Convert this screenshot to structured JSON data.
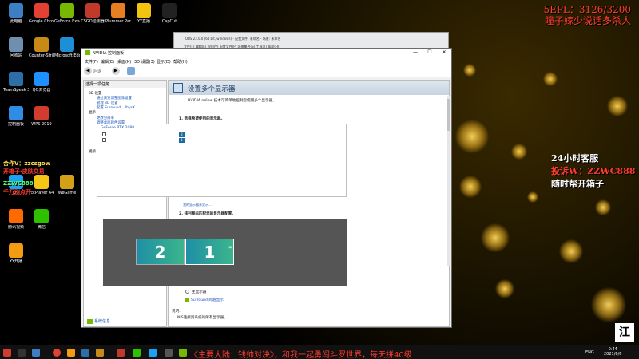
{
  "overlay": {
    "score": "5EPL：3126/3200",
    "line2": "瞳子嫁少说话多杀人",
    "service1": "24小时客服",
    "service2": "投诉W：ZZWC888",
    "service3": "随时帮开箱子",
    "ad1": "合作V：zzcsgow",
    "ad2": "开箱子·皮肤交易",
    "ad3": "ZZWC888",
    "ad4": "千万别点开"
  },
  "desktop_icons": [
    {
      "label": "此电脑",
      "color": "#3d7fc4"
    },
    {
      "label": "Google Chrome",
      "color": "#e34133"
    },
    {
      "label": "GeForce Experience",
      "color": "#76b900"
    },
    {
      "label": "CSGO检测器",
      "color": "#c0392b"
    },
    {
      "label": "Plummer Party",
      "color": "#e67e22"
    },
    {
      "label": "YY直播",
      "color": "#f1c40f"
    },
    {
      "label": "CapCut",
      "color": "#222222"
    },
    {
      "label": "回收站",
      "color": "#6f8fb0"
    },
    {
      "label": "Counter-Strike Global Off...",
      "color": "#c88a16"
    },
    {
      "label": "Microsoft Edge",
      "color": "#1e8fd6"
    },
    {
      "label": "TeamSpeak 3",
      "color": "#2b6ea8"
    },
    {
      "label": "QQ浏览器",
      "color": "#1e90ff"
    },
    {
      "label": "控制面板",
      "color": "#2f8de4"
    },
    {
      "label": "WPS 2019",
      "color": "#d23c2e"
    },
    {
      "label": "QQ",
      "color": "#1da1f2"
    },
    {
      "label": "PotPlayer 64 bit",
      "color": "#f5c518"
    },
    {
      "label": "WeGame",
      "color": "#d4a017"
    },
    {
      "label": "腾讯视频",
      "color": "#ff6a00"
    },
    {
      "label": "微信",
      "color": "#2dc100"
    },
    {
      "label": "YY开播",
      "color": "#f39c12"
    }
  ],
  "obs": {
    "title": "OBS 23.0.0 (64 bit, windows) - 配置文件: 未命名 - 场景: 未命名",
    "menu": "文件(F)  编辑(E)  视图(V)  配置文件(P)  场景集合(S)  工具(T)  帮助(H)"
  },
  "window": {
    "title": "NVIDIA 控制面板",
    "menu": [
      "文件(F)",
      "编辑(E)",
      "桌面(K)",
      "3D 设置(3)",
      "显示(D)",
      "帮助(H)"
    ],
    "back_label": "后退",
    "task_header": "选择一项任务...",
    "tree": [
      {
        "text": "3D 设置",
        "kind": "cat"
      },
      {
        "text": "通过预览调整图像设置",
        "kind": "sub"
      },
      {
        "text": "管理 3D 设置",
        "kind": "sub"
      },
      {
        "text": "配置 Surround、PhysX",
        "kind": "sub"
      },
      {
        "text": "显示",
        "kind": "cat"
      },
      {
        "text": "更改分辨率",
        "kind": "sub"
      },
      {
        "text": "调整桌面颜色设置",
        "kind": "sub"
      },
      {
        "text": "旋转显示器",
        "kind": "sub"
      },
      {
        "text": "查看 HDCP 状态",
        "kind": "sub"
      },
      {
        "text": "设置数字音频",
        "kind": "sub"
      },
      {
        "text": "调整桌面尺寸和位置",
        "kind": "sub"
      },
      {
        "text": "设置多个显示器",
        "kind": "sel"
      },
      {
        "text": "视频",
        "kind": "cat"
      },
      {
        "text": "调整视频颜色设置",
        "kind": "sub"
      },
      {
        "text": "调整视频图像设置",
        "kind": "sub"
      }
    ],
    "system_info": "系统信息",
    "page_title": "设置多个显示器",
    "intro": "NVIDIA nView 技术可简单地控制您使用多个显示器。",
    "step1": "1.  选择希望使用的显示器。",
    "gpu": "GeForce RTX 2080",
    "monitors": [
      {
        "name": "AOC 2701",
        "num": "2",
        "checked": true
      },
      {
        "name": "BenQ ZOWIE XL LCD",
        "num": "1",
        "checked": true
      }
    ],
    "help_link": "我的显示器未显示...",
    "step2": "2.  排列图标匹配您的显示器配置。",
    "arrange": [
      {
        "num": "2",
        "primary": false
      },
      {
        "num": "1",
        "primary": true
      }
    ],
    "primary_label": "主显示器",
    "surround_link": "Surround 跨越显示",
    "desc_label": "说明:",
    "desc_text": "NIS连接到系统的所有显示器。"
  },
  "taskbar": {
    "marquee": "《主要大陆：钱帅对决》，和我一起勇闯斗罗世界，每天拼40级",
    "lang": "ENG",
    "time": "0:44",
    "date": "2021/6/6"
  },
  "corner_logo": "江"
}
